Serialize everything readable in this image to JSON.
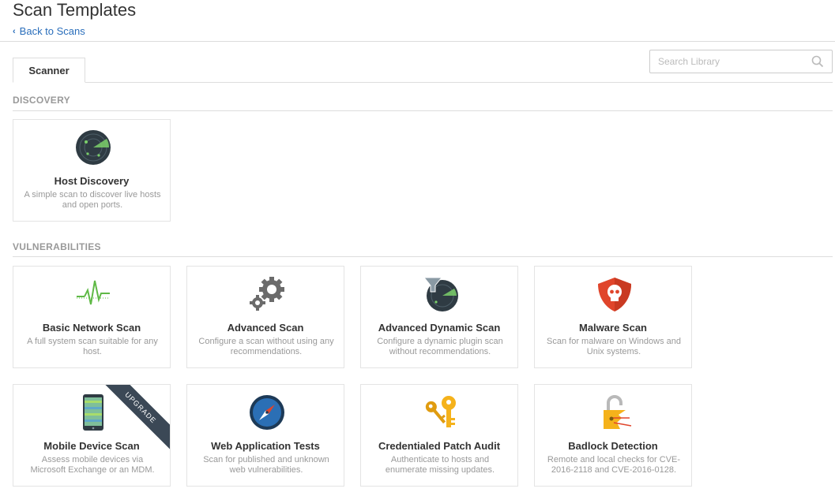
{
  "page": {
    "title": "Scan Templates",
    "back_label": "Back to Scans"
  },
  "tabs": [
    {
      "label": "Scanner"
    }
  ],
  "search": {
    "placeholder": "Search Library"
  },
  "sections": {
    "discovery": "DISCOVERY",
    "vulnerabilities": "VULNERABILITIES"
  },
  "cards": {
    "host_discovery": {
      "title": "Host Discovery",
      "desc": "A simple scan to discover live hosts and open ports.",
      "icon": "radar-icon"
    },
    "basic_network": {
      "title": "Basic Network Scan",
      "desc": "A full system scan suitable for any host.",
      "icon": "pulse-icon"
    },
    "advanced": {
      "title": "Advanced Scan",
      "desc": "Configure a scan without using any recommendations.",
      "icon": "gears-icon"
    },
    "advanced_dynamic": {
      "title": "Advanced Dynamic Scan",
      "desc": "Configure a dynamic plugin scan without recommendations.",
      "icon": "filter-radar-icon"
    },
    "malware": {
      "title": "Malware Scan",
      "desc": "Scan for malware on Windows and Unix systems.",
      "icon": "skull-shield-icon"
    },
    "mobile": {
      "title": "Mobile Device Scan",
      "desc": "Assess mobile devices via Microsoft Exchange or an MDM.",
      "icon": "phone-icon",
      "badge": "UPGRADE"
    },
    "web_app": {
      "title": "Web Application Tests",
      "desc": "Scan for published and unknown web vulnerabilities.",
      "icon": "compass-icon"
    },
    "patch_audit": {
      "title": "Credentialed Patch Audit",
      "desc": "Authenticate to hosts and enumerate missing updates.",
      "icon": "keys-icon"
    },
    "badlock": {
      "title": "Badlock Detection",
      "desc": "Remote and local checks for CVE-2016-2118 and CVE-2016-0128.",
      "icon": "broken-lock-icon"
    }
  },
  "colors": {
    "link": "#2a6ebb",
    "malware_red": "#e0452b",
    "keys_yellow": "#f5b21b",
    "ribbon": "#3b4856"
  }
}
